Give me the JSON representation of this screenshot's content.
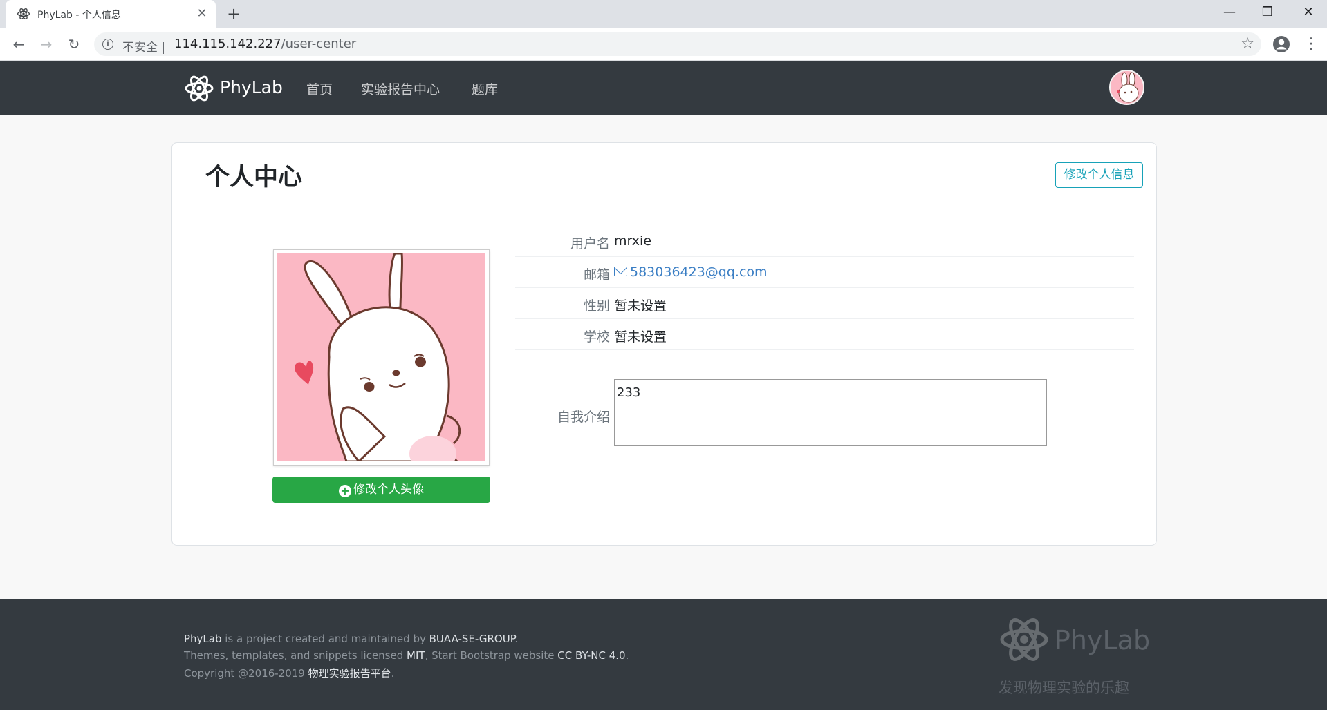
{
  "browser": {
    "tab_title": "PhyLab - 个人信息",
    "tab_close": "✕",
    "new_tab": "+",
    "window_controls": {
      "minimize": "—",
      "maximize": "❐",
      "close": "✕"
    },
    "security_label": "不安全 |",
    "url_host": "114.115.142.227",
    "url_path": "/user-center",
    "icons": [
      "back-icon",
      "forward-icon",
      "reload-icon",
      "info-icon",
      "star-icon",
      "profile-icon",
      "menu-icon"
    ]
  },
  "nav": {
    "brand": "PhyLab",
    "links": [
      "首页",
      "实验报告中心",
      "题库"
    ]
  },
  "profile": {
    "title": "个人中心",
    "edit_button": "修改个人信息",
    "avatar_button": "修改个人头像",
    "fields": [
      {
        "label": "用户名",
        "value": "mrxie"
      },
      {
        "label": "邮箱",
        "value": "583036423@qq.com"
      },
      {
        "label": "性别",
        "value": "暂未设置"
      },
      {
        "label": "学校",
        "value": "暂未设置"
      }
    ],
    "bio_label": "自我介绍",
    "bio_value": "233"
  },
  "footer": {
    "line1": {
      "project": "PhyLab",
      "text": " is a project created and maintained by ",
      "group": "BUAA-SE-GROUP",
      "end": "."
    },
    "line2": {
      "text": "Themes, templates, and snippets licensed ",
      "license": "MIT",
      "mid": ", Start Bootstrap website ",
      "cc": "CC BY-NC 4.0",
      "end": "."
    },
    "line3": {
      "text": "Copyright @2016-2019 ",
      "platform": "物理实验报告平台",
      "end": "."
    },
    "brand": "PhyLab",
    "tagline": "发现物理实验的乐趣"
  },
  "colors": {
    "navbar": "#343a40",
    "accent_info": "#17a2b8",
    "success": "#28a745",
    "link": "#3a7ec4",
    "avatar_bg": "#fbb8c4"
  }
}
